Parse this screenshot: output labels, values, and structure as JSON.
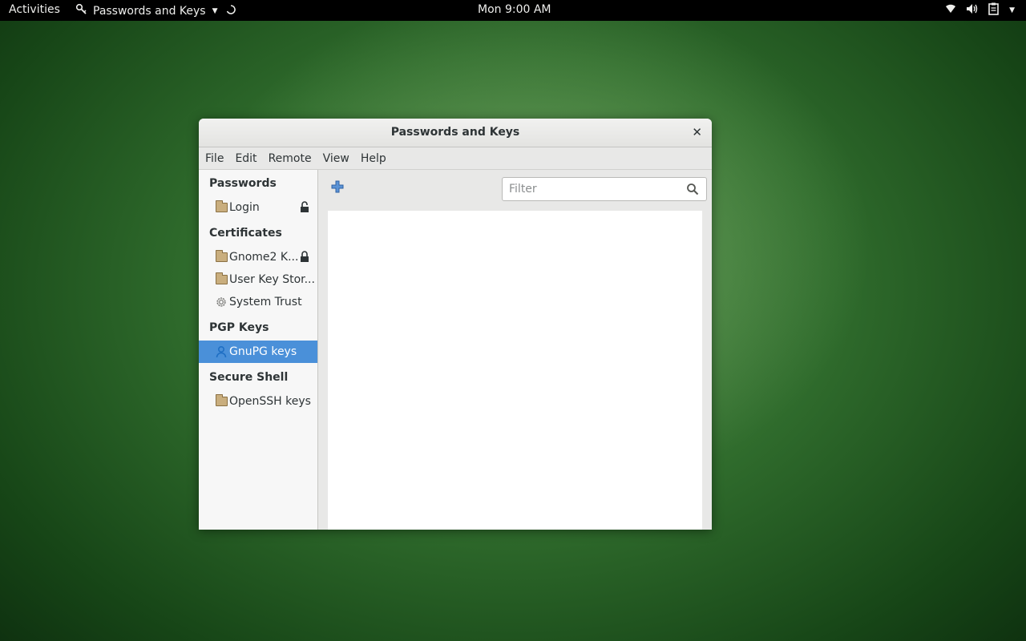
{
  "topbar": {
    "activities": "Activities",
    "app_name": "Passwords and Keys",
    "clock": "Mon  9:00 AM"
  },
  "window": {
    "title": "Passwords and Keys",
    "menu": [
      "File",
      "Edit",
      "Remote",
      "View",
      "Help"
    ]
  },
  "sidebar": {
    "sections": [
      {
        "header": "Passwords",
        "items": [
          {
            "label": "Login",
            "icon": "folder-icon",
            "locked": true
          }
        ]
      },
      {
        "header": "Certificates",
        "items": [
          {
            "label": "Gnome2 K...",
            "icon": "folder-icon",
            "locked": true
          },
          {
            "label": "User Key Stor...",
            "icon": "folder-icon",
            "locked": false
          },
          {
            "label": "System Trust",
            "icon": "gear-icon",
            "locked": false
          }
        ]
      },
      {
        "header": "PGP Keys",
        "items": [
          {
            "label": "GnuPG keys",
            "icon": "person-icon",
            "locked": false,
            "selected": true
          }
        ]
      },
      {
        "header": "Secure Shell",
        "items": [
          {
            "label": "OpenSSH keys",
            "icon": "folder-icon",
            "locked": false
          }
        ]
      }
    ]
  },
  "toolbar": {
    "filter_placeholder": "Filter"
  },
  "colors": {
    "selection": "#4a90d9",
    "topbar": "#000000",
    "desktop": "#2f6b2c"
  }
}
